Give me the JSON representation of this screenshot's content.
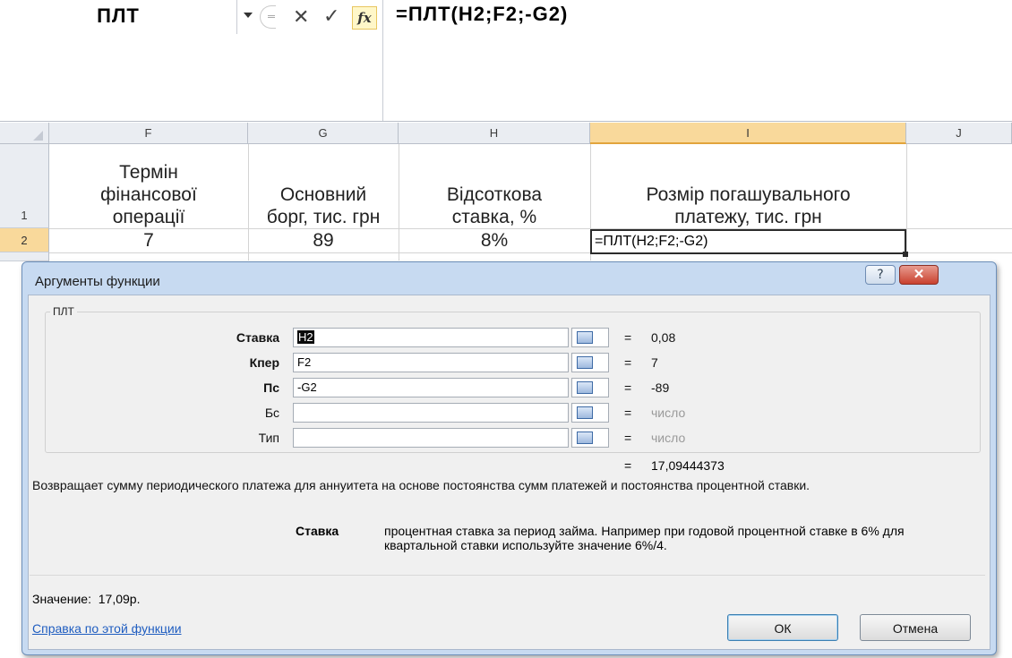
{
  "formula_bar": {
    "name_box": "ПЛТ",
    "cancel_glyph": "✕",
    "enter_glyph": "✓",
    "fx_label": "fx",
    "formula": "=ПЛТ(H2;F2;-G2)"
  },
  "columns": [
    "F",
    "G",
    "H",
    "I",
    "J"
  ],
  "rows": [
    "1",
    "2"
  ],
  "cells": {
    "F1": [
      "Термін",
      "фінансової",
      "операції"
    ],
    "G1": [
      "Основний",
      "борг, тис. грн"
    ],
    "H1": [
      "Відсоткова",
      "ставка, %"
    ],
    "I1": [
      "Розмір погашувального",
      "платежу, тис. грн"
    ],
    "F2": "7",
    "G2": "89",
    "H2": "8%",
    "I2": "=ПЛТ(H2;F2;-G2)"
  },
  "dialog": {
    "title": "Аргументы функции",
    "help_glyph": "?",
    "close_glyph": "✕",
    "function_name": "ПЛТ",
    "args": [
      {
        "label": "Ставка",
        "bold": true,
        "value": "H2",
        "result": "0,08",
        "result_grey": false
      },
      {
        "label": "Кпер",
        "bold": true,
        "value": "F2",
        "result": "7",
        "result_grey": false
      },
      {
        "label": "Пс",
        "bold": true,
        "value": "-G2",
        "result": "-89",
        "result_grey": false
      },
      {
        "label": "Бс",
        "bold": false,
        "value": "",
        "result": "число",
        "result_grey": true
      },
      {
        "label": "Тип",
        "bold": false,
        "value": "",
        "result": "число",
        "result_grey": true
      }
    ],
    "equals_sign": "=",
    "formula_result": "17,09444373",
    "description": "Возвращает сумму периодического платежа для аннуитета на основе постоянства сумм платежей и постоянства процентной ставки.",
    "param_name": "Ставка",
    "param_description": "процентная ставка за период займа. Например при годовой процентной ставке в 6% для квартальной ставки используйте значение 6%/4.",
    "value_label": "Значение:",
    "value": "17,09р.",
    "help_link": "Справка по этой функции",
    "ok": "ОК",
    "cancel": "Отмена"
  }
}
